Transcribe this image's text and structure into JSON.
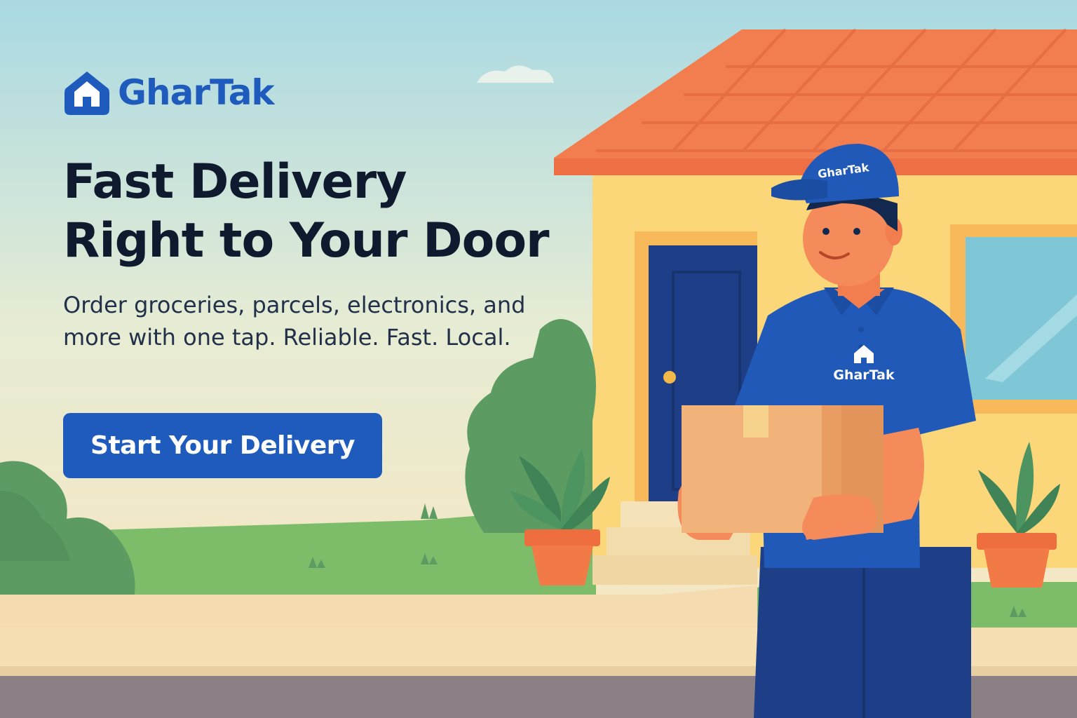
{
  "brand": {
    "name": "GharTak",
    "icon": "house-icon"
  },
  "hero": {
    "headline_line1": "Fast Delivery",
    "headline_line2": "Right to Your Door",
    "tagline": "Order groceries, parcels, electronics, and more with one tap. Reliable. Fast. Local."
  },
  "cta": {
    "label": "Start Your Delivery"
  },
  "courier": {
    "cap_text": "GharTak",
    "shirt_text": "GharTak"
  },
  "colors": {
    "brand_blue": "#1f5bbd",
    "headline": "#101a2e",
    "roof": "#f27d4e",
    "wall": "#fbd77a",
    "door": "#1e3f87",
    "grass": "#7dbd6a"
  }
}
